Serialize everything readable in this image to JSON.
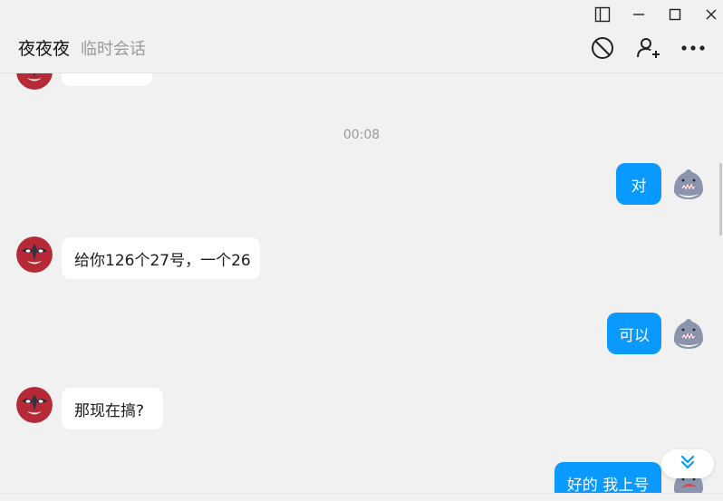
{
  "window": {
    "controls": [
      "sidebar-toggle-icon",
      "minimize-icon",
      "maximize-icon",
      "close-icon"
    ]
  },
  "header": {
    "title": "夜夜夜",
    "subtitle": "临时会话",
    "actions": [
      "block-icon",
      "add-contact-icon",
      "more-icon"
    ]
  },
  "chat": {
    "timestamp": "00:08",
    "messages": [
      {
        "side": "in",
        "text": ""
      },
      {
        "side": "out",
        "text": "对"
      },
      {
        "side": "in",
        "text": "给你126个27号，一个26"
      },
      {
        "side": "out",
        "text": "可以"
      },
      {
        "side": "in",
        "text": "那现在搞?"
      },
      {
        "side": "out",
        "text": "好的 我上号"
      }
    ]
  },
  "colors": {
    "background": "#f1f1f1",
    "outgoing_bubble": "#0a99ff",
    "incoming_bubble": "#ffffff",
    "accent": "#0a99ff"
  }
}
